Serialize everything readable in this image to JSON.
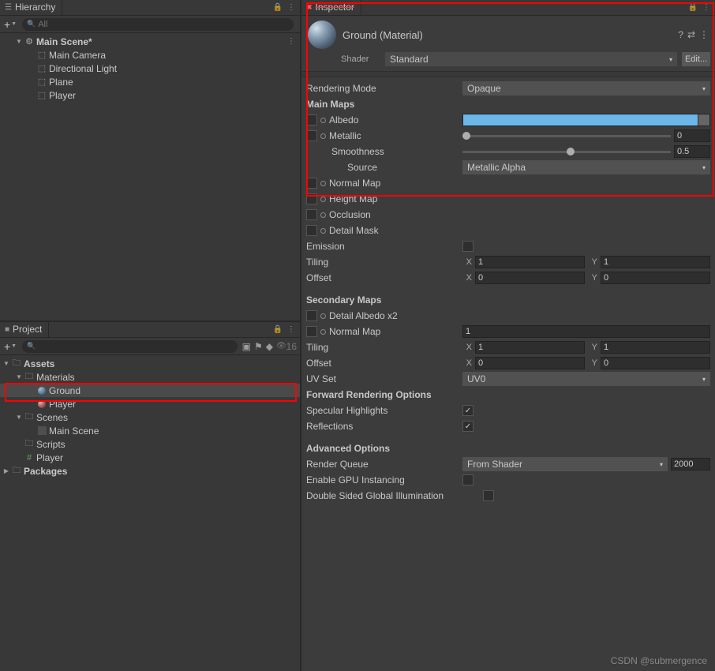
{
  "hierarchy": {
    "title": "Hierarchy",
    "search_placeholder": "All",
    "scene": "Main Scene*",
    "items": [
      "Main Camera",
      "Directional Light",
      "Plane",
      "Player"
    ]
  },
  "project": {
    "title": "Project",
    "hidden_count": "16",
    "tree": {
      "assets": "Assets",
      "materials": "Materials",
      "ground": "Ground",
      "player_mat": "Player",
      "scenes": "Scenes",
      "main_scene": "Main Scene",
      "scripts": "Scripts",
      "player_script": "Player",
      "packages": "Packages"
    }
  },
  "inspector": {
    "title": "Inspector",
    "mat_name": "Ground (Material)",
    "shader_label": "Shader",
    "shader_value": "Standard",
    "edit_btn": "Edit...",
    "rendering_mode_l": "Rendering Mode",
    "rendering_mode_v": "Opaque",
    "main_maps": "Main Maps",
    "albedo": "Albedo",
    "metallic": "Metallic",
    "metallic_v": "0",
    "smoothness": "Smoothness",
    "smoothness_v": "0.5",
    "source": "Source",
    "source_v": "Metallic Alpha",
    "normal_map": "Normal Map",
    "height_map": "Height Map",
    "occlusion": "Occlusion",
    "detail_mask": "Detail Mask",
    "emission": "Emission",
    "tiling": "Tiling",
    "tiling_x": "1",
    "tiling_y": "1",
    "offset": "Offset",
    "offset_x": "0",
    "offset_y": "0",
    "secondary_maps": "Secondary Maps",
    "detail_albedo": "Detail Albedo x2",
    "normal_map2": "Normal Map",
    "normal_map2_v": "1",
    "tiling2_x": "1",
    "tiling2_y": "1",
    "offset2_x": "0",
    "offset2_y": "0",
    "uv_set": "UV Set",
    "uv_set_v": "UV0",
    "fwd_render": "Forward Rendering Options",
    "spec_hl": "Specular Highlights",
    "reflections": "Reflections",
    "adv_opts": "Advanced Options",
    "render_queue": "Render Queue",
    "render_queue_src": "From Shader",
    "render_queue_v": "2000",
    "gpu_inst": "Enable GPU Instancing",
    "dsgi": "Double Sided Global Illumination",
    "x_label": "X",
    "y_label": "Y"
  },
  "watermark": "CSDN @submergence"
}
